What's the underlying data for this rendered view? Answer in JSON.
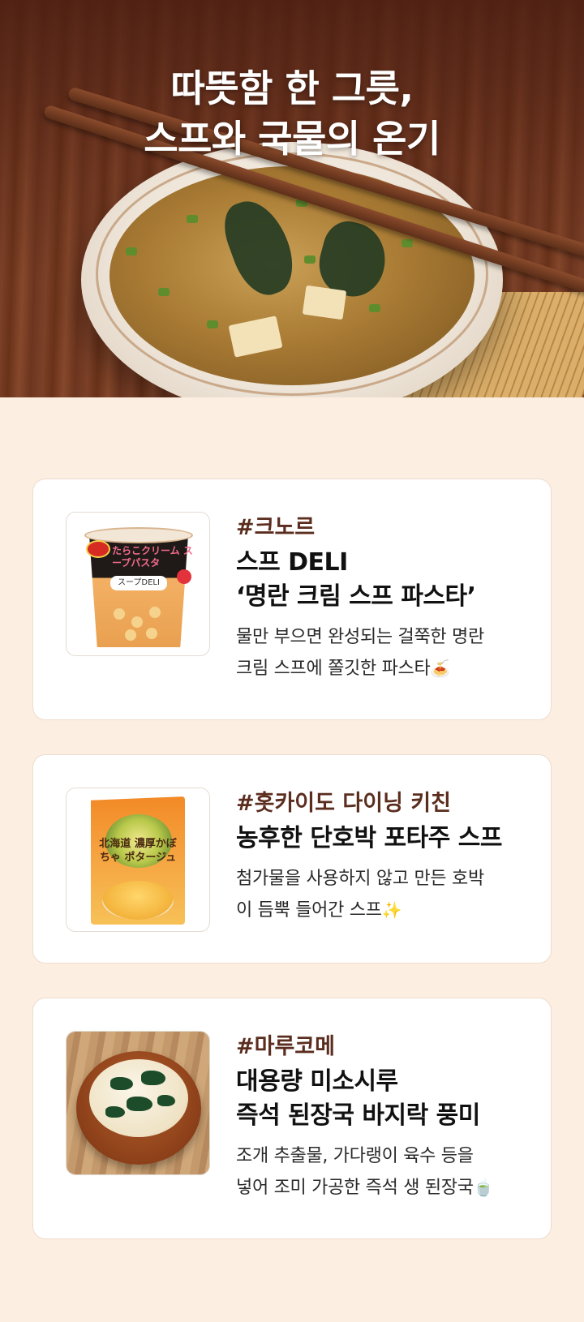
{
  "hero": {
    "title_line1": "따뜻함 한 그릇,",
    "title_line2": "스프와 국물의 온기"
  },
  "products": [
    {
      "brand": "#크노르",
      "name_line1": "스프 DELI",
      "name_line2": "‘명란 크림 스프 파스타’",
      "desc_line1": "물만 부으면 완성되는 걸쭉한 명란",
      "desc_line2": "크림 스프에 쫄깃한 파스타",
      "emoji": "🍝",
      "image": {
        "jp_text": "たらこクリーム スープパスタ",
        "label": "スープDELI"
      }
    },
    {
      "brand": "#홋카이도 다이닝 키친",
      "name_line1": "농후한 단호박 포타주 스프",
      "desc_line1": "첨가물을 사용하지 않고 만든 호박",
      "desc_line2": "이 듬뿍 들어간 스프",
      "emoji": "✨",
      "image": {
        "jp_text": "北海道 濃厚かぼちゃ ポタージュ"
      }
    },
    {
      "brand": "#마루코메",
      "name_line1": "대용량 미소시루",
      "name_line2": "즉석 된장국 바지락 풍미",
      "desc_line1": "조개 추출물, 가다랭이 육수 등을",
      "desc_line2": "넣어 조미 가공한 즉석 생 된장국",
      "emoji": "🍵"
    }
  ],
  "colors": {
    "page_bg": "#fdeee2",
    "brand_text": "#5b2d1e",
    "card_bg": "#ffffff",
    "hero_wood": "#703a22"
  },
  "icons": [
    "spaghetti-emoji-icon",
    "sparkles-emoji-icon",
    "soup-bowl-emoji-icon"
  ]
}
